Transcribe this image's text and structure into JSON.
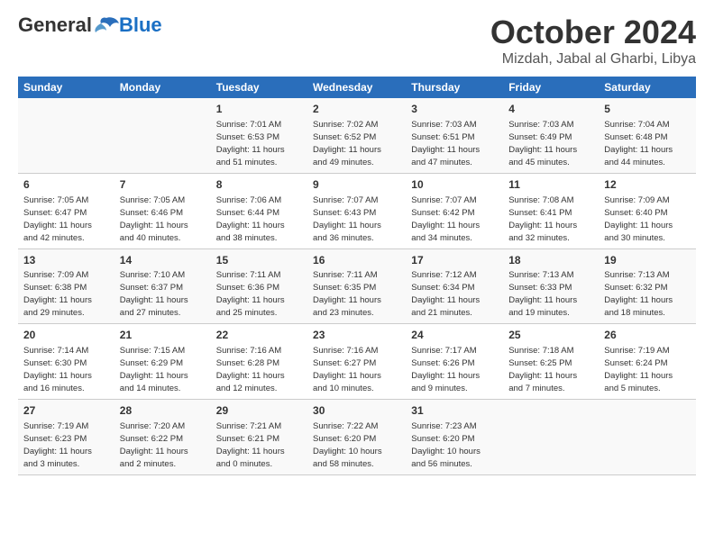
{
  "header": {
    "logo": {
      "general": "General",
      "blue": "Blue"
    },
    "month": "October 2024",
    "location": "Mizdah, Jabal al Gharbi, Libya"
  },
  "weekdays": [
    "Sunday",
    "Monday",
    "Tuesday",
    "Wednesday",
    "Thursday",
    "Friday",
    "Saturday"
  ],
  "weeks": [
    [
      {
        "day": "",
        "detail": ""
      },
      {
        "day": "",
        "detail": ""
      },
      {
        "day": "1",
        "detail": "Sunrise: 7:01 AM\nSunset: 6:53 PM\nDaylight: 11 hours\nand 51 minutes."
      },
      {
        "day": "2",
        "detail": "Sunrise: 7:02 AM\nSunset: 6:52 PM\nDaylight: 11 hours\nand 49 minutes."
      },
      {
        "day": "3",
        "detail": "Sunrise: 7:03 AM\nSunset: 6:51 PM\nDaylight: 11 hours\nand 47 minutes."
      },
      {
        "day": "4",
        "detail": "Sunrise: 7:03 AM\nSunset: 6:49 PM\nDaylight: 11 hours\nand 45 minutes."
      },
      {
        "day": "5",
        "detail": "Sunrise: 7:04 AM\nSunset: 6:48 PM\nDaylight: 11 hours\nand 44 minutes."
      }
    ],
    [
      {
        "day": "6",
        "detail": "Sunrise: 7:05 AM\nSunset: 6:47 PM\nDaylight: 11 hours\nand 42 minutes."
      },
      {
        "day": "7",
        "detail": "Sunrise: 7:05 AM\nSunset: 6:46 PM\nDaylight: 11 hours\nand 40 minutes."
      },
      {
        "day": "8",
        "detail": "Sunrise: 7:06 AM\nSunset: 6:44 PM\nDaylight: 11 hours\nand 38 minutes."
      },
      {
        "day": "9",
        "detail": "Sunrise: 7:07 AM\nSunset: 6:43 PM\nDaylight: 11 hours\nand 36 minutes."
      },
      {
        "day": "10",
        "detail": "Sunrise: 7:07 AM\nSunset: 6:42 PM\nDaylight: 11 hours\nand 34 minutes."
      },
      {
        "day": "11",
        "detail": "Sunrise: 7:08 AM\nSunset: 6:41 PM\nDaylight: 11 hours\nand 32 minutes."
      },
      {
        "day": "12",
        "detail": "Sunrise: 7:09 AM\nSunset: 6:40 PM\nDaylight: 11 hours\nand 30 minutes."
      }
    ],
    [
      {
        "day": "13",
        "detail": "Sunrise: 7:09 AM\nSunset: 6:38 PM\nDaylight: 11 hours\nand 29 minutes."
      },
      {
        "day": "14",
        "detail": "Sunrise: 7:10 AM\nSunset: 6:37 PM\nDaylight: 11 hours\nand 27 minutes."
      },
      {
        "day": "15",
        "detail": "Sunrise: 7:11 AM\nSunset: 6:36 PM\nDaylight: 11 hours\nand 25 minutes."
      },
      {
        "day": "16",
        "detail": "Sunrise: 7:11 AM\nSunset: 6:35 PM\nDaylight: 11 hours\nand 23 minutes."
      },
      {
        "day": "17",
        "detail": "Sunrise: 7:12 AM\nSunset: 6:34 PM\nDaylight: 11 hours\nand 21 minutes."
      },
      {
        "day": "18",
        "detail": "Sunrise: 7:13 AM\nSunset: 6:33 PM\nDaylight: 11 hours\nand 19 minutes."
      },
      {
        "day": "19",
        "detail": "Sunrise: 7:13 AM\nSunset: 6:32 PM\nDaylight: 11 hours\nand 18 minutes."
      }
    ],
    [
      {
        "day": "20",
        "detail": "Sunrise: 7:14 AM\nSunset: 6:30 PM\nDaylight: 11 hours\nand 16 minutes."
      },
      {
        "day": "21",
        "detail": "Sunrise: 7:15 AM\nSunset: 6:29 PM\nDaylight: 11 hours\nand 14 minutes."
      },
      {
        "day": "22",
        "detail": "Sunrise: 7:16 AM\nSunset: 6:28 PM\nDaylight: 11 hours\nand 12 minutes."
      },
      {
        "day": "23",
        "detail": "Sunrise: 7:16 AM\nSunset: 6:27 PM\nDaylight: 11 hours\nand 10 minutes."
      },
      {
        "day": "24",
        "detail": "Sunrise: 7:17 AM\nSunset: 6:26 PM\nDaylight: 11 hours\nand 9 minutes."
      },
      {
        "day": "25",
        "detail": "Sunrise: 7:18 AM\nSunset: 6:25 PM\nDaylight: 11 hours\nand 7 minutes."
      },
      {
        "day": "26",
        "detail": "Sunrise: 7:19 AM\nSunset: 6:24 PM\nDaylight: 11 hours\nand 5 minutes."
      }
    ],
    [
      {
        "day": "27",
        "detail": "Sunrise: 7:19 AM\nSunset: 6:23 PM\nDaylight: 11 hours\nand 3 minutes."
      },
      {
        "day": "28",
        "detail": "Sunrise: 7:20 AM\nSunset: 6:22 PM\nDaylight: 11 hours\nand 2 minutes."
      },
      {
        "day": "29",
        "detail": "Sunrise: 7:21 AM\nSunset: 6:21 PM\nDaylight: 11 hours\nand 0 minutes."
      },
      {
        "day": "30",
        "detail": "Sunrise: 7:22 AM\nSunset: 6:20 PM\nDaylight: 10 hours\nand 58 minutes."
      },
      {
        "day": "31",
        "detail": "Sunrise: 7:23 AM\nSunset: 6:20 PM\nDaylight: 10 hours\nand 56 minutes."
      },
      {
        "day": "",
        "detail": ""
      },
      {
        "day": "",
        "detail": ""
      }
    ]
  ]
}
